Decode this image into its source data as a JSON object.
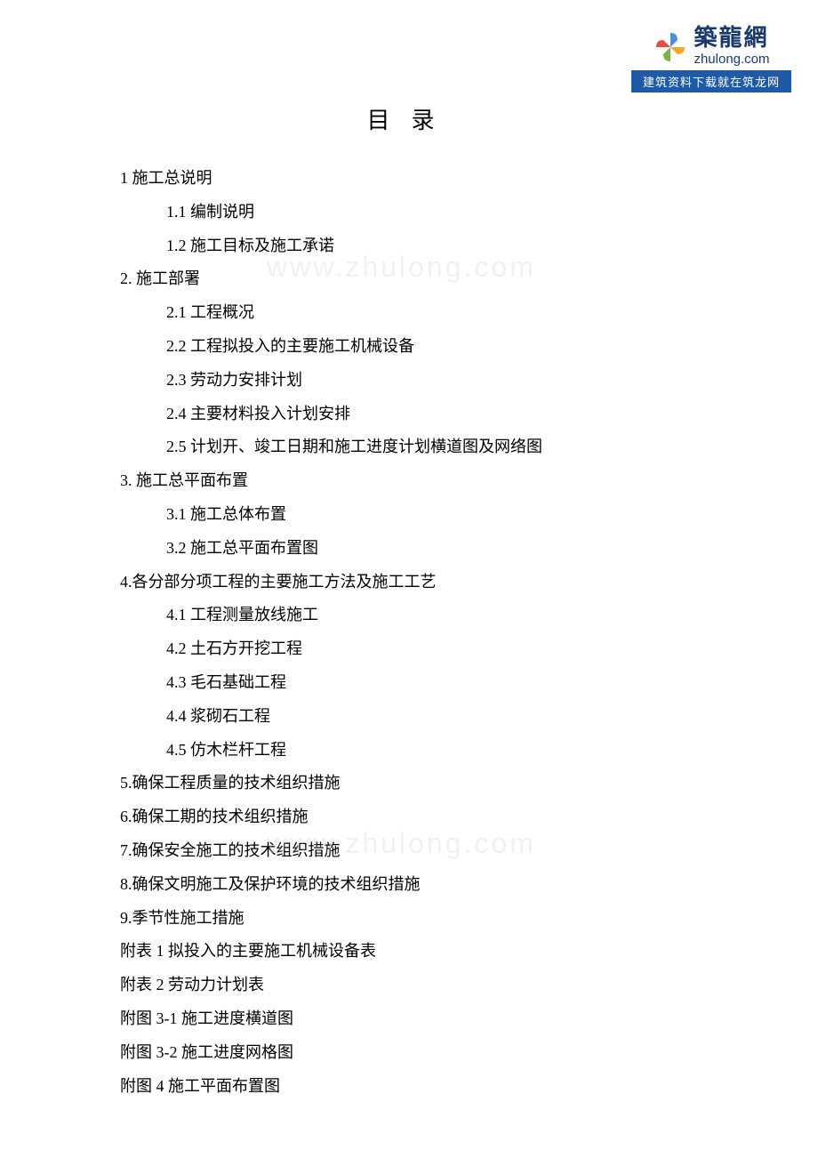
{
  "logo": {
    "name_cn": "築龍網",
    "name_en": "zhulong.com",
    "banner": "建筑资料下载就在筑龙网"
  },
  "title": "目录",
  "watermark": "www.zhulong.com",
  "toc": [
    {
      "level": 1,
      "text": "1 施工总说明"
    },
    {
      "level": 2,
      "text": "1.1 编制说明"
    },
    {
      "level": 2,
      "text": "1.2 施工目标及施工承诺"
    },
    {
      "level": 1,
      "text": "2. 施工部署"
    },
    {
      "level": 2,
      "text": "2.1 工程概况"
    },
    {
      "level": 2,
      "text": "2.2 工程拟投入的主要施工机械设备"
    },
    {
      "level": 2,
      "text": "2.3 劳动力安排计划"
    },
    {
      "level": 2,
      "text": "2.4 主要材料投入计划安排"
    },
    {
      "level": 2,
      "text": "2.5 计划开、竣工日期和施工进度计划横道图及网络图"
    },
    {
      "level": 1,
      "text": "3. 施工总平面布置"
    },
    {
      "level": 2,
      "text": "3.1 施工总体布置"
    },
    {
      "level": 2,
      "text": "3.2 施工总平面布置图"
    },
    {
      "level": 1,
      "text": "4.各分部分项工程的主要施工方法及施工工艺"
    },
    {
      "level": 2,
      "text": "4.1 工程测量放线施工"
    },
    {
      "level": 2,
      "text": "4.2 土石方开挖工程"
    },
    {
      "level": 2,
      "text": "4.3 毛石基础工程"
    },
    {
      "level": 2,
      "text": "4.4 浆砌石工程"
    },
    {
      "level": 2,
      "text": "4.5 仿木栏杆工程"
    },
    {
      "level": 1,
      "text": "5.确保工程质量的技术组织措施"
    },
    {
      "level": 1,
      "text": "6.确保工期的技术组织措施"
    },
    {
      "level": 1,
      "text": "7.确保安全施工的技术组织措施"
    },
    {
      "level": 1,
      "text": "8.确保文明施工及保护环境的技术组织措施"
    },
    {
      "level": 1,
      "text": "9.季节性施工措施"
    },
    {
      "level": 1,
      "text": "附表 1 拟投入的主要施工机械设备表"
    },
    {
      "level": 1,
      "text": "附表 2 劳动力计划表"
    },
    {
      "level": 1,
      "text": "附图 3-1 施工进度横道图"
    },
    {
      "level": 1,
      "text": "附图 3-2 施工进度网格图"
    },
    {
      "level": 1,
      "text": "附图 4  施工平面布置图"
    }
  ]
}
